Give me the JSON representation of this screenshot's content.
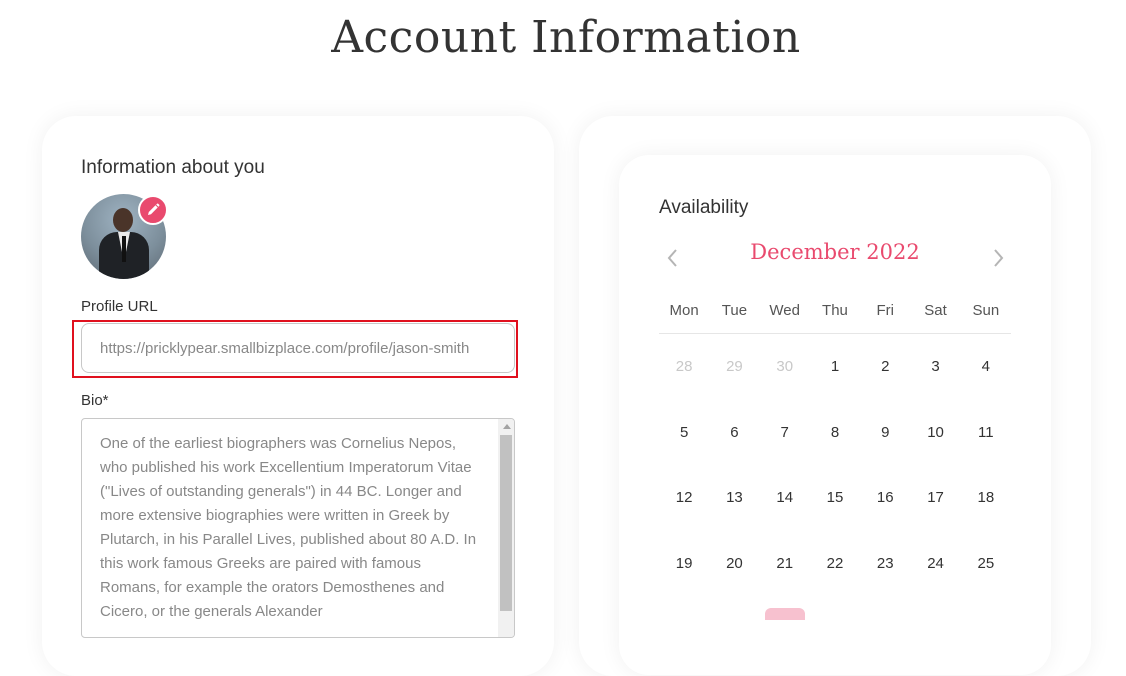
{
  "page": {
    "title": "Account Information"
  },
  "profile": {
    "section_heading": "Information about you",
    "profile_url_label": "Profile URL",
    "profile_url_value": "https://pricklypear.smallbizplace.com/profile/jason-smith",
    "bio_label": "Bio*",
    "bio_text": "One of the earliest biographers was Cornelius Nepos, who published his work Excellentium Imperatorum Vitae (\"Lives of outstanding generals\") in 44 BC. Longer and more extensive biographies were written in Greek by Plutarch, in his Parallel Lives, published about 80 A.D. In this work famous Greeks are paired with famous Romans, for example the orators Demosthenes and Cicero, or the generals Alexander"
  },
  "availability": {
    "heading": "Availability",
    "month_label": "December 2022",
    "weekdays": [
      "Mon",
      "Tue",
      "Wed",
      "Thu",
      "Fri",
      "Sat",
      "Sun"
    ],
    "weeks": [
      [
        "28",
        "29",
        "30",
        "1",
        "2",
        "3",
        "4"
      ],
      [
        "5",
        "6",
        "7",
        "8",
        "9",
        "10",
        "11"
      ],
      [
        "12",
        "13",
        "14",
        "15",
        "16",
        "17",
        "18"
      ],
      [
        "19",
        "20",
        "21",
        "22",
        "23",
        "24",
        "25"
      ]
    ],
    "muted_days": [
      "28",
      "29",
      "30"
    ]
  },
  "colors": {
    "accent": "#e94a6e",
    "highlight_border": "#e0101e"
  }
}
